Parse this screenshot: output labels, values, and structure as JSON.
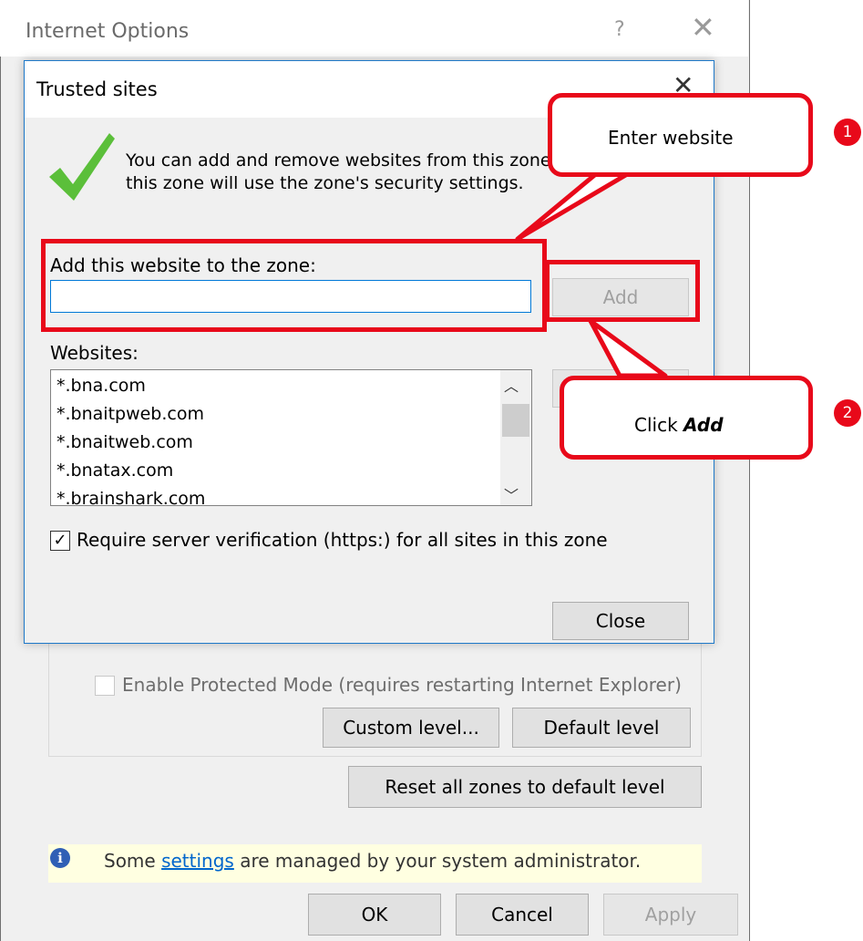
{
  "internet_options": {
    "title": "Internet Options",
    "help_glyph": "?",
    "close_glyph": "✕",
    "protected_mode_label": "Enable Protected Mode (requires restarting Internet Explorer)",
    "custom_level_label": "Custom level...",
    "default_level_label": "Default level",
    "reset_zones_label": "Reset all zones to default level",
    "admin_notice_prefix": "Some ",
    "admin_notice_link": "settings",
    "admin_notice_suffix": " are managed by your system administrator.",
    "ok_label": "OK",
    "cancel_label": "Cancel",
    "apply_label": "Apply"
  },
  "trusted_sites": {
    "title": "Trusted sites",
    "close_glyph": "✕",
    "info_line1": "You can add and remove websites from this zone",
    "info_line2": "this zone will use the zone's security settings.",
    "add_label": "Add this website to the zone:",
    "input_value": "",
    "add_button": "Add",
    "websites_label": "Websites:",
    "websites": [
      "*.bna.com",
      "*.bnaitpweb.com",
      "*.bnaitweb.com",
      "*.bnatax.com",
      "*.brainshark.com"
    ],
    "require_verification_label": "Require server verification (https:) for all sites in this zone",
    "require_verification_checked": true,
    "close_button": "Close"
  },
  "annotations": {
    "step1_number": "1",
    "step1_text": "Enter website",
    "step2_number": "2",
    "step2_prefix": "Click ",
    "step2_emphasis": "Add"
  },
  "colors": {
    "annotation_red": "#e8091a",
    "dialog_border": "#1e78c8",
    "check_green": "#5bbf3a"
  }
}
